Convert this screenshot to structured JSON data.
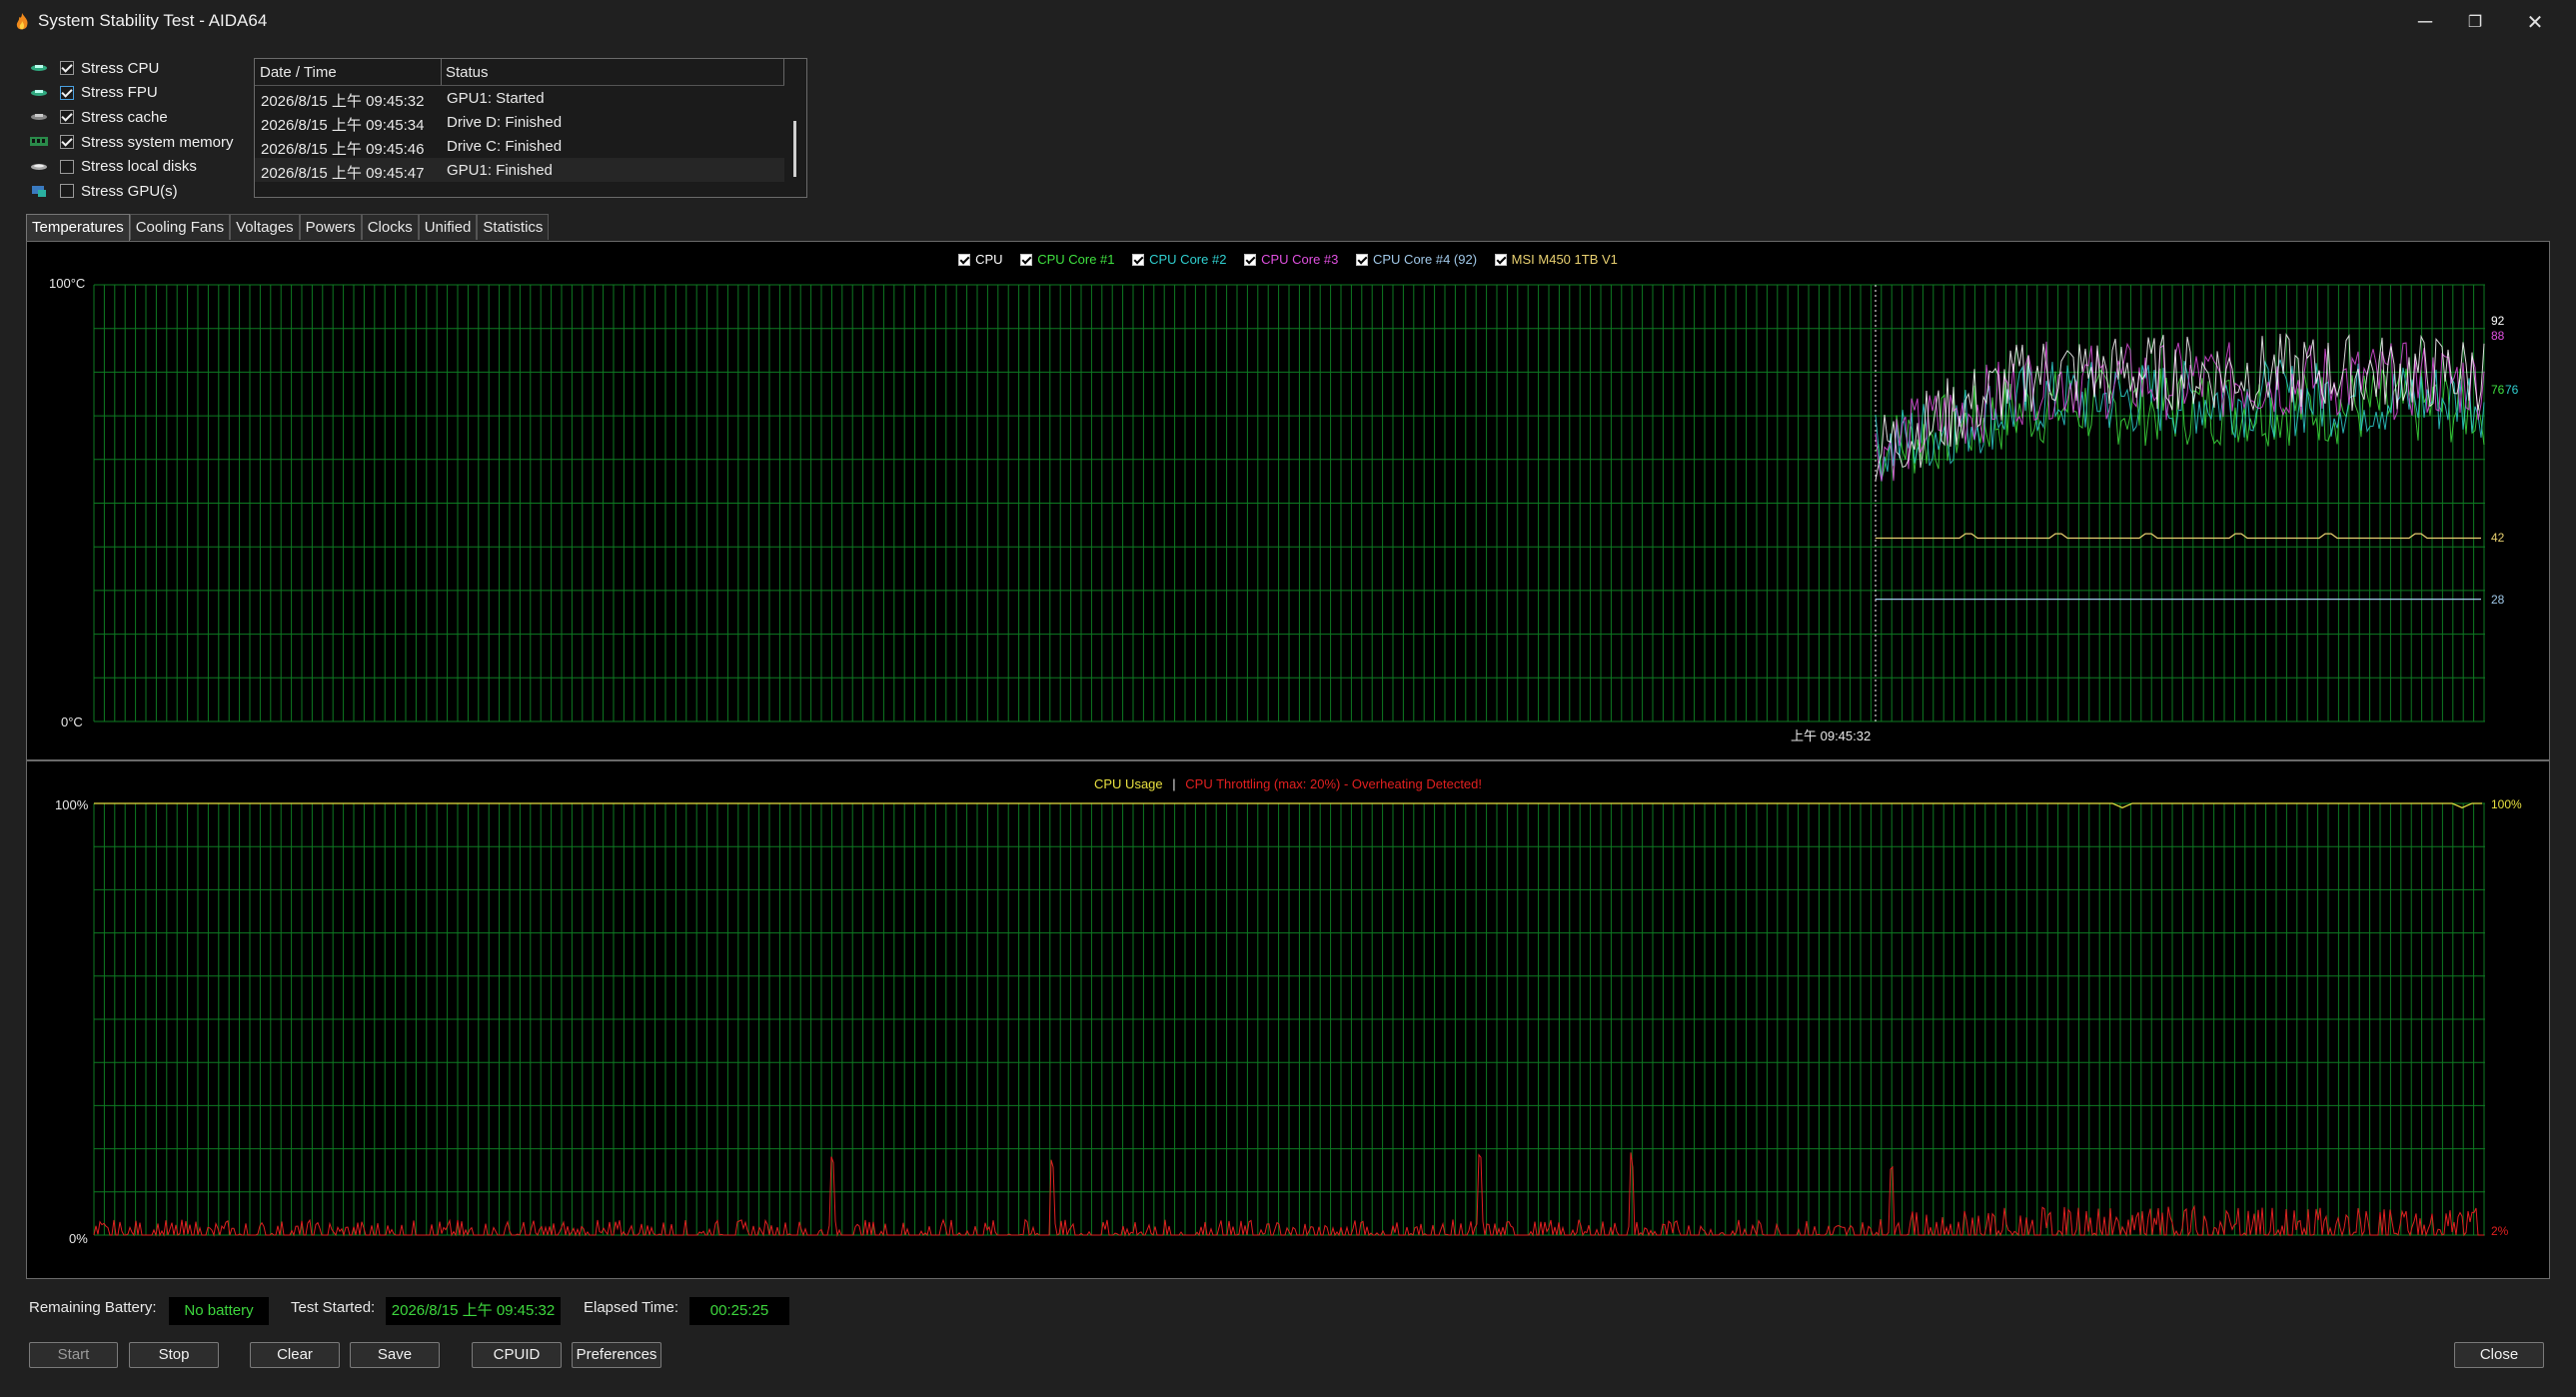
{
  "window": {
    "title": "System Stability Test - AIDA64",
    "controls": {
      "minimize": "─",
      "restore": "❐",
      "close": "✕"
    }
  },
  "stress_options": [
    {
      "label": "Stress CPU",
      "checked": true,
      "icon": "cpu-chip-icon"
    },
    {
      "label": "Stress FPU",
      "checked": true,
      "icon": "fpu-chip-icon"
    },
    {
      "label": "Stress cache",
      "checked": true,
      "icon": "cache-icon"
    },
    {
      "label": "Stress system memory",
      "checked": true,
      "icon": "memory-module-icon"
    },
    {
      "label": "Stress local disks",
      "checked": false,
      "icon": "disk-icon"
    },
    {
      "label": "Stress GPU(s)",
      "checked": false,
      "icon": "gpu-icon"
    }
  ],
  "log": {
    "columns": [
      "Date / Time",
      "Status"
    ],
    "rows": [
      {
        "time": "2026/8/15 上午 09:45:32",
        "status": "GPU1: Started"
      },
      {
        "time": "2026/8/15 上午 09:45:34",
        "status": "Drive D: Finished"
      },
      {
        "time": "2026/8/15 上午 09:45:46",
        "status": "Drive C: Finished"
      },
      {
        "time": "2026/8/15 上午 09:45:47",
        "status": "GPU1: Finished"
      }
    ]
  },
  "tabs": [
    "Temperatures",
    "Cooling Fans",
    "Voltages",
    "Powers",
    "Clocks",
    "Unified",
    "Statistics"
  ],
  "active_tab": "Temperatures",
  "temp_graph": {
    "legend": [
      {
        "label": "CPU",
        "color": "#ffffff"
      },
      {
        "label": "CPU Core #1",
        "color": "#3fe03f"
      },
      {
        "label": "CPU Core #2",
        "color": "#30d0d0"
      },
      {
        "label": "CPU Core #3",
        "color": "#e050e0"
      },
      {
        "label": "CPU Core #4 (92)",
        "color": "#a0c8e8"
      },
      {
        "label": "MSI M450 1TB V1",
        "color": "#e8d070"
      }
    ],
    "y_top": "100°C",
    "y_bottom": "0°C",
    "time_marker": "上午 09:45:32",
    "current_values": [
      {
        "text": "92",
        "color": "#ffffff"
      },
      {
        "text": "88",
        "color": "#e050e0"
      },
      {
        "text": "76",
        "color": "#3fe03f"
      },
      {
        "text": "76",
        "color": "#30d0d0"
      },
      {
        "text": "42",
        "color": "#e8d070"
      },
      {
        "text": "28",
        "color": "#a0c8e8"
      }
    ]
  },
  "usage_graph": {
    "title_usage": "CPU Usage",
    "title_sep": "|",
    "title_throttle": "CPU Throttling (max: 20%) - Overheating Detected!",
    "usage_color": "#e8e040",
    "throttle_color": "#e02020",
    "y_top": "100%",
    "y_bottom": "0%",
    "right_top": "100%",
    "right_bottom": "2%"
  },
  "chart_data": [
    {
      "type": "line",
      "title": "",
      "y_unit": "°C",
      "ylim": [
        0,
        100
      ],
      "x_marker": "上午 09:45:32",
      "series": [
        {
          "name": "CPU",
          "last_value": 92,
          "color": "#ffffff"
        },
        {
          "name": "CPU Core #1",
          "last_value": 76,
          "color": "#3fe03f"
        },
        {
          "name": "CPU Core #2",
          "last_value": 76,
          "color": "#30d0d0"
        },
        {
          "name": "CPU Core #3",
          "last_value": 88,
          "color": "#e050e0"
        },
        {
          "name": "CPU Core #4 (92)",
          "last_value": 28,
          "color": "#a0c8e8"
        },
        {
          "name": "MSI M450 1TB V1",
          "last_value": 42,
          "color": "#e8d070"
        }
      ],
      "grid": true
    },
    {
      "type": "line",
      "title": "CPU Usage | CPU Throttling (max: 20%) - Overheating Detected!",
      "y_unit": "%",
      "ylim": [
        0,
        100
      ],
      "series": [
        {
          "name": "CPU Usage",
          "last_value": 100,
          "color": "#e8e040"
        },
        {
          "name": "CPU Throttling",
          "last_value": 2,
          "max": 20,
          "color": "#e02020"
        }
      ],
      "grid": true
    }
  ],
  "status_bar": {
    "battery_label": "Remaining Battery:",
    "battery_value": "No battery",
    "started_label": "Test Started:",
    "started_value": "2026/8/15 上午 09:45:32",
    "elapsed_label": "Elapsed Time:",
    "elapsed_value": "00:25:25"
  },
  "buttons": {
    "start": "Start",
    "stop": "Stop",
    "clear": "Clear",
    "save": "Save",
    "cpuid": "CPUID",
    "preferences": "Preferences",
    "close": "Close"
  }
}
